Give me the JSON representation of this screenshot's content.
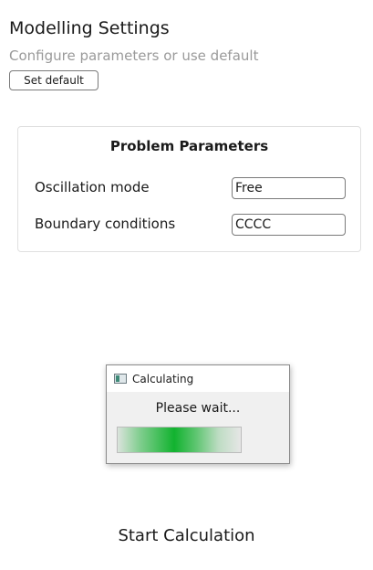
{
  "header": {
    "title": "Modelling Settings",
    "subtitle": "Configure parameters or use default",
    "set_default_label": "Set default"
  },
  "parameters": {
    "title": "Problem Parameters",
    "oscillation_mode": {
      "label": "Oscillation mode",
      "value": "Free"
    },
    "boundary_conditions": {
      "label": "Boundary conditions",
      "value": "CCCC"
    }
  },
  "dialog": {
    "title": "Calculating",
    "icon": "window-icon",
    "message": "Please wait...",
    "progress_color": "#06b025"
  },
  "footer": {
    "start_label": "Start Calculation"
  }
}
